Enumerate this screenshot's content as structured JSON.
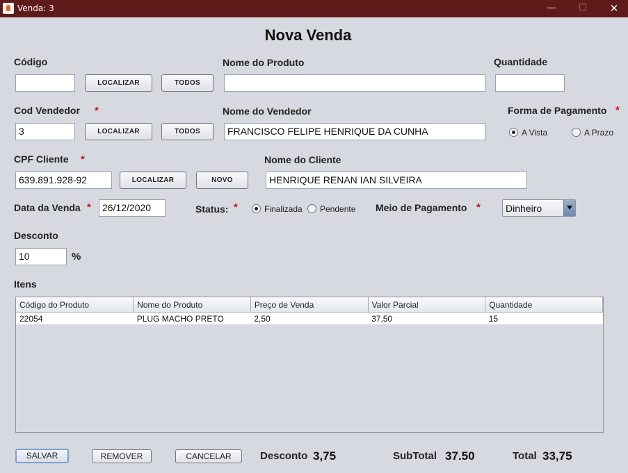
{
  "window": {
    "title": "Venda: 3",
    "min": "—",
    "max": "☐",
    "close": "✕"
  },
  "form": {
    "heading": "Nova Venda",
    "codigo": {
      "label": "Código",
      "value": ""
    },
    "nome_produto": {
      "label": "Nome do Produto",
      "value": ""
    },
    "quantidade": {
      "label": "Quantidade",
      "value": ""
    },
    "cod_vendedor": {
      "label": "Cod Vendedor",
      "value": "3"
    },
    "nome_vendedor": {
      "label": "Nome do Vendedor",
      "value": "FRANCISCO FELIPE HENRIQUE DA CUNHA"
    },
    "forma_pagamento": {
      "label": "Forma de Pagamento",
      "options": [
        "A Vista",
        "A Prazo"
      ],
      "selected": "A Vista"
    },
    "cpf_cliente": {
      "label": "CPF Cliente",
      "value": "639.891.928-92"
    },
    "nome_cliente": {
      "label": "Nome do Cliente",
      "value": "HENRIQUE RENAN IAN SILVEIRA"
    },
    "data_venda": {
      "label": "Data da Venda",
      "value": "26/12/2020"
    },
    "status": {
      "label": "Status:",
      "options": [
        "Finalizada",
        "Pendente"
      ],
      "selected": "Finalizada"
    },
    "meio_pagamento": {
      "label": "Meio de Pagamento",
      "value": "Dinheiro"
    },
    "desconto": {
      "label": "Desconto",
      "value": "10",
      "unit": "%"
    },
    "required_mark": "*"
  },
  "buttons": {
    "localizar": "LOCALIZAR",
    "todos": "TODOS",
    "novo": "NOVO",
    "salvar": "SALVAR",
    "remover": "REMOVER",
    "cancelar": "CANCELAR"
  },
  "itens": {
    "label": "Itens",
    "columns": [
      "Código do Produto",
      "Nome do Produto",
      "Preço de Venda",
      "Valor Parcial",
      "Quantidade"
    ],
    "rows": [
      [
        "22054",
        "PLUG MACHO PRETO",
        "2,50",
        "37,50",
        "15"
      ]
    ]
  },
  "totals": {
    "desconto_label": "Desconto",
    "desconto_value": "3,75",
    "subtotal_label": "SubTotal",
    "subtotal_value": "37.50",
    "total_label": "Total",
    "total_value": "33,75"
  },
  "colors": {
    "titlebar": "#5f1a1a",
    "background": "#d6d9df",
    "required": "#cc1111"
  }
}
